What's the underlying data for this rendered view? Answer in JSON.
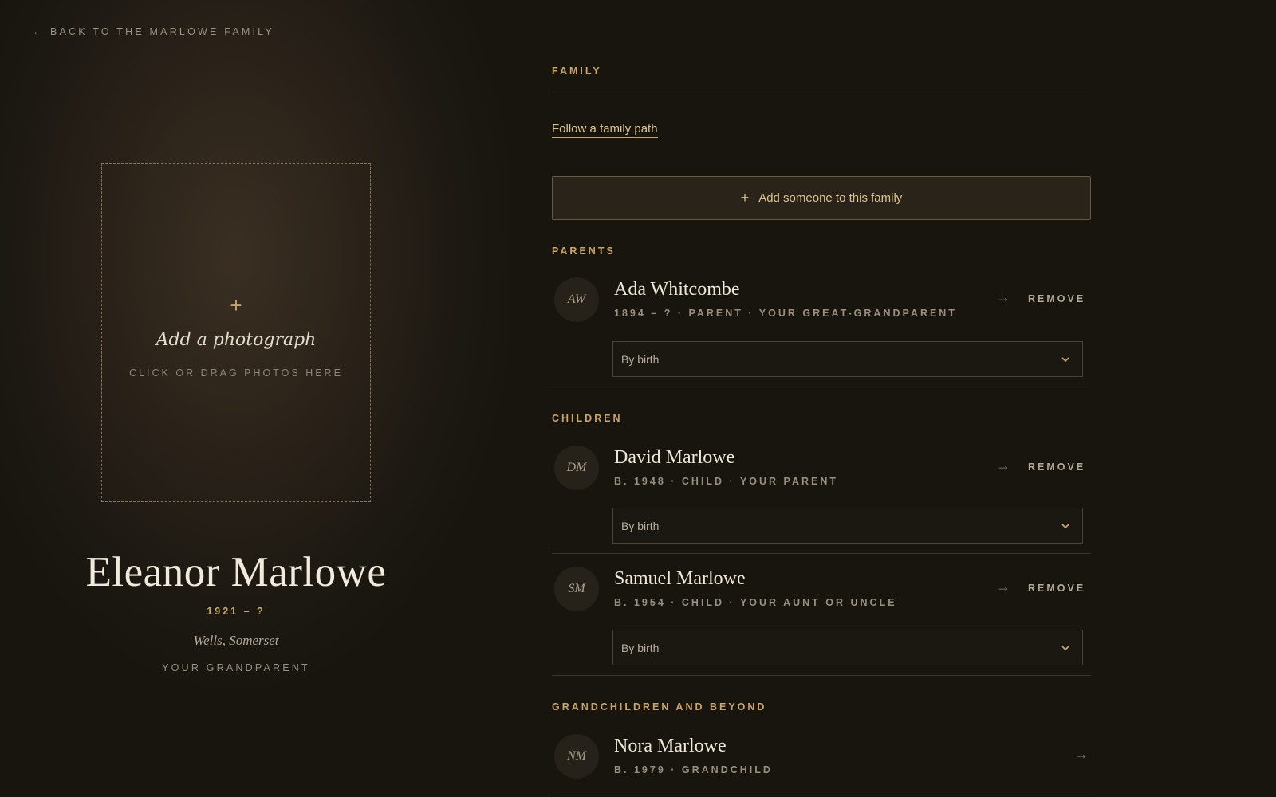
{
  "nav": {
    "back_arrow": "←",
    "back_label": "BACK TO THE MARLOWE FAMILY"
  },
  "photo": {
    "plus": "+",
    "title": "Add a photograph",
    "hint": "CLICK OR DRAG PHOTOS HERE"
  },
  "person": {
    "name": "Eleanor Marlowe",
    "dates": "1921 – ?",
    "place": "Wells, Somerset",
    "relation": "YOUR GRANDPARENT"
  },
  "family": {
    "section_label": "FAMILY",
    "path_link": "Follow a family path",
    "add_plus": "+",
    "add_label": "Add someone to this family"
  },
  "groups": {
    "parents": "PARENTS",
    "children": "CHILDREN",
    "grandchildren": "GRANDCHILDREN AND BEYOND"
  },
  "members": {
    "ada": {
      "initials": "AW",
      "name": "Ada Whitcombe",
      "meta": "1894 – ? · PARENT · YOUR GREAT-GRANDPARENT",
      "go": "→",
      "remove": "REMOVE",
      "relation_type": "By birth"
    },
    "david": {
      "initials": "DM",
      "name": "David Marlowe",
      "meta": "B. 1948 · CHILD · YOUR PARENT",
      "go": "→",
      "remove": "REMOVE",
      "relation_type": "By birth"
    },
    "samuel": {
      "initials": "SM",
      "name": "Samuel Marlowe",
      "meta": "B. 1954 · CHILD · YOUR AUNT OR UNCLE",
      "go": "→",
      "remove": "REMOVE",
      "relation_type": "By birth"
    },
    "nora": {
      "initials": "NM",
      "name": "Nora Marlowe",
      "meta": "B. 1979 · GRANDCHILD",
      "go": "→"
    }
  },
  "colors": {
    "accent": "#c9a567",
    "background": "#18150f"
  },
  "icons": {
    "back": "arrow-left-icon",
    "go": "arrow-right-icon",
    "select": "chevron-down-icon",
    "add": "plus-icon"
  }
}
